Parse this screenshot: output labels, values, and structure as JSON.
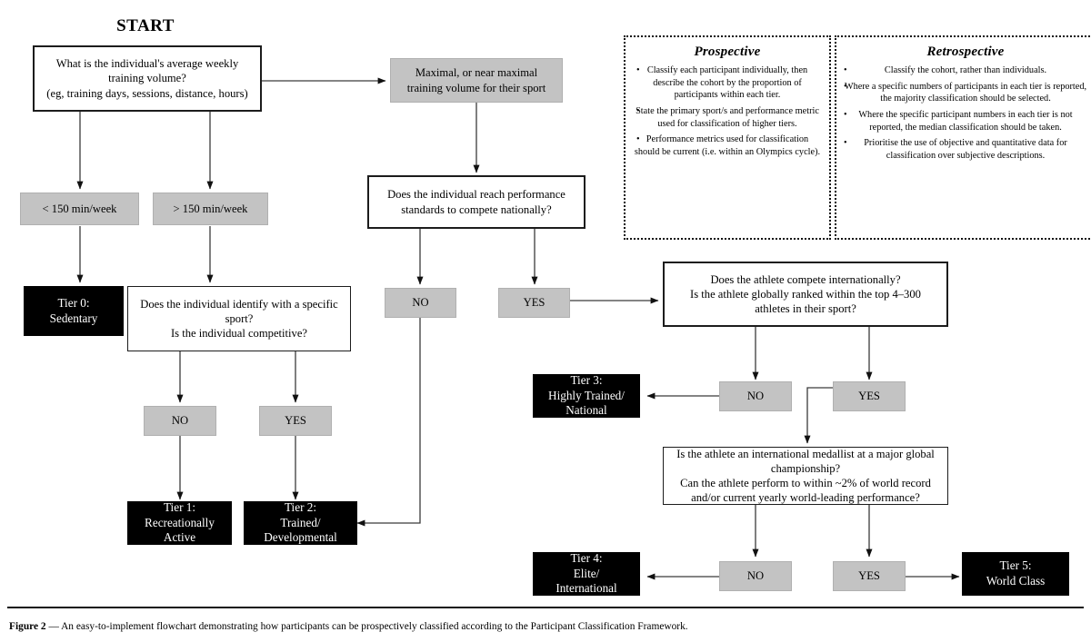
{
  "figure": {
    "start_label": "START",
    "caption_prefix": "Figure 2",
    "caption_dash": "—",
    "caption_text": "An easy-to-implement flowchart demonstrating how participants can be prospectively classified according to the Participant Classification Framework."
  },
  "colors": {
    "grey_fill": "#c3c3c3",
    "tier_fill": "#000000",
    "tier_text": "#ffffff",
    "outline": "#1c1c1c",
    "arrow": "#3a3a3a",
    "background": "#ffffff"
  },
  "nodes": {
    "start_question": "What is the individual's average weekly\ntraining volume?\n(eg, training days, sessions, distance, hours)",
    "volume_low": "< 150 min/week",
    "volume_high": "> 150 min/week",
    "tier0": "Tier 0:\nSedentary",
    "identify_sport": "Does the individual identify with a specific\nsport?\nIs the individual competitive?",
    "identify_no": "NO",
    "identify_yes": "YES",
    "tier1": "Tier 1:\nRecreationally\nActive",
    "tier2": "Tier 2:\nTrained/\nDevelopmental",
    "maximal_volume": "Maximal, or near maximal\ntraining volume for their sport",
    "national_standard": "Does the individual reach performance\nstandards to compete nationally?",
    "national_no": "NO",
    "national_yes": "YES",
    "international_question": "Does the athlete compete internationally?\nIs the athlete globally ranked within the top 4–300\nathletes in their sport?",
    "international_no": "NO",
    "international_yes": "YES",
    "tier3": "Tier 3:\nHighly Trained/\nNational",
    "medallist_question": "Is the athlete an international medallist at a major global\nchampionship?\nCan the athlete perform to within ~2% of world record\nand/or current yearly world-leading performance?",
    "medallist_no": "NO",
    "medallist_yes": "YES",
    "tier4": "Tier 4:\nElite/\nInternational",
    "tier5": "Tier 5:\nWorld Class"
  },
  "panels": {
    "prospective": {
      "title": "Prospective",
      "items": [
        "Classify each participant individually, then describe the cohort by the proportion of participants within each tier.",
        "State the primary sport/s and performance metric used for classification of higher tiers.",
        "Performance metrics used for classification should be current (i.e. within an Olympics cycle)."
      ]
    },
    "retrospective": {
      "title": "Retrospective",
      "items": [
        "Classify the cohort, rather than individuals.",
        "Where a specific numbers of participants in each tier is reported, the majority classification should be selected.",
        "Where the specific participant numbers in each tier is not reported, the median classification should be taken.",
        "Prioritise the use of objective and quantitative data for classification over subjective descriptions."
      ]
    }
  }
}
